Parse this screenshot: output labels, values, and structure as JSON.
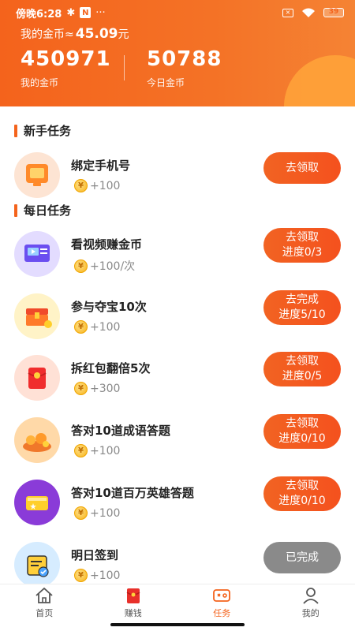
{
  "status": {
    "time": "傍晚6:28",
    "bluetooth": "bluetooth-icon",
    "dots": "···",
    "battery": "39"
  },
  "header": {
    "coin_label": "我的金币≈",
    "coin_value": "45.09",
    "coin_unit": "元",
    "stats": [
      {
        "value": "450971",
        "label": "我的金币"
      },
      {
        "value": "50788",
        "label": "今日金币"
      }
    ]
  },
  "sections": {
    "newbie": "新手任务",
    "daily": "每日任务"
  },
  "tasks": [
    {
      "name": "绑定手机号",
      "reward": "+100",
      "button": [
        "去领取"
      ],
      "done": false
    },
    {
      "name": "看视频赚金币",
      "reward": "+100/次",
      "button": [
        "去领取",
        "进度0/3"
      ],
      "done": false
    },
    {
      "name": "参与夺宝10次",
      "reward": "+100",
      "button": [
        "去完成",
        "进度5/10"
      ],
      "done": false
    },
    {
      "name": "拆红包翻倍5次",
      "reward": "+300",
      "button": [
        "去领取",
        "进度0/5"
      ],
      "done": false
    },
    {
      "name": "答对10道成语答题",
      "reward": "+100",
      "button": [
        "去领取",
        "进度0/10"
      ],
      "done": false
    },
    {
      "name": "答对10道百万英雄答题",
      "reward": "+100",
      "button": [
        "去领取",
        "进度0/10"
      ],
      "done": false
    },
    {
      "name": "明日签到",
      "reward": "+100",
      "button": [
        "已完成"
      ],
      "done": true
    }
  ],
  "coin_symbol": "¥",
  "tabs": [
    {
      "label": "首页",
      "icon": "home-icon",
      "active": false
    },
    {
      "label": "赚钱",
      "icon": "red-envelope-icon",
      "active": false
    },
    {
      "label": "任务",
      "icon": "task-icon",
      "active": true
    },
    {
      "label": "我的",
      "icon": "profile-icon",
      "active": false
    }
  ],
  "colors": {
    "accent": "#f4631c",
    "done": "#8a8a8a"
  }
}
